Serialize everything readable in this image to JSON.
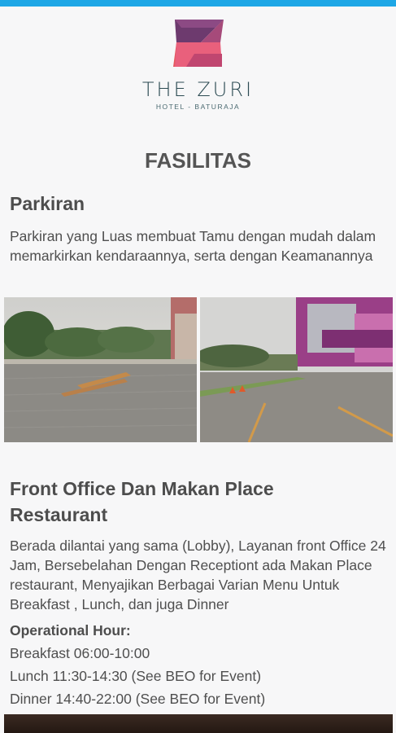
{
  "status_bar": {
    "color": "#1ea7e6"
  },
  "logo": {
    "icon": "zuri-logo-icon",
    "name": "THE ZURI",
    "subtitle": "HOTEL - BATURAJA"
  },
  "page_title": "FASILITAS",
  "sections": [
    {
      "title": "Parkiran",
      "description": "Parkiran yang Luas membuat Tamu dengan mudah dalam memarkirkan kendaraannya, serta dengan Keamanannya",
      "photos": [
        "parking-lot-photo",
        "hotel-parking-photo"
      ]
    },
    {
      "title": "Front Office Dan Makan Place Restaurant",
      "description": "Berada dilantai yang sama (Lobby), Layanan front Office 24 Jam, Bersebelahan Dengan Receptiont ada Makan Place restaurant, Menyajikan Berbagai Varian Menu Untuk Breakfast , Lunch, dan juga Dinner",
      "hours_title": "Operational Hour:",
      "hours": [
        "Breakfast 06:00-10:00",
        "Lunch 11:30-14:30 (See BEO for Event)",
        "Dinner 14:40-22:00 (See BEO for Event)"
      ],
      "photo": "restaurant-photo"
    }
  ]
}
